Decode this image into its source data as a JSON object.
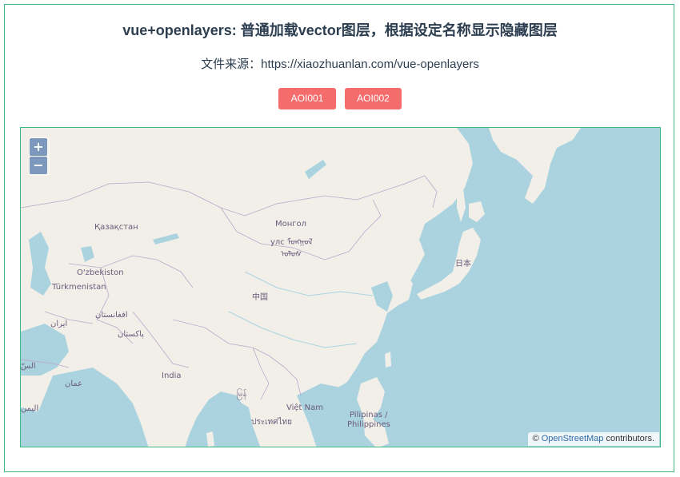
{
  "header": {
    "title": "vue+openlayers: 普通加载vector图层，根据设定名称显示隐藏图层",
    "source": "文件来源：https://xiaozhuanlan.com/vue-openlayers"
  },
  "buttons": [
    {
      "label": "AOI001"
    },
    {
      "label": "AOI002"
    }
  ],
  "map": {
    "zoom_in": "+",
    "zoom_out": "−",
    "attribution_prefix": "©",
    "attribution_link": "OpenStreetMap",
    "attribution_suffix": "contributors.",
    "labels": {
      "kazakhstan": "Қазақстан",
      "mongolia": "Монгол",
      "mongolia_script1": "улс ᠮᠣᠩᠭᠣᠯ",
      "mongolia_script2": "ᠤᠯᠤᠰ",
      "japan": "日本",
      "uzbekistan": "O'zbekiston",
      "turkmenistan": "Türkmenistan",
      "china": "中国",
      "afghanistan": "افغانستان",
      "iran": "ایران",
      "pakistan": "پاکستان",
      "india": "India",
      "oman": "عمان",
      "yemen": "اليمن",
      "saudi": "السّ",
      "myanmar": "မြန်",
      "vietnam": "Việt Nam",
      "thailand": "ประเทศไทย",
      "philippines1": "Pilipinas /",
      "philippines2": "Philippines"
    }
  }
}
